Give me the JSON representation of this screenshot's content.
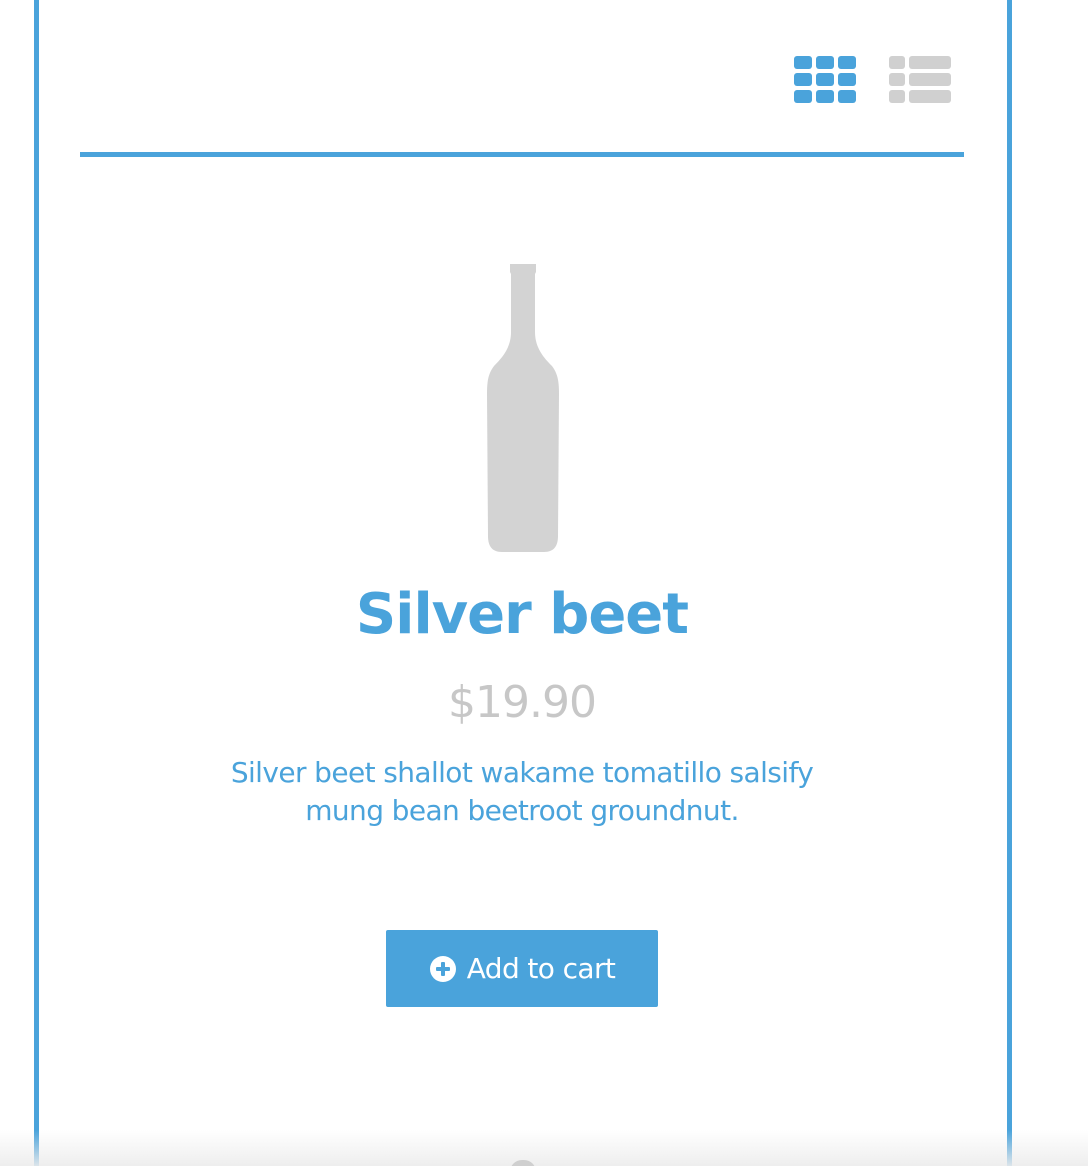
{
  "colors": {
    "accent": "#4aa3db",
    "price": "#c7c7c7",
    "inactive_icon": "#d0d0d0",
    "placeholder_image": "#d3d3d3"
  },
  "view_toggle": {
    "grid_icon": "grid-icon",
    "list_icon": "list-icon",
    "active": "grid"
  },
  "product": {
    "image_icon": "bottle-icon",
    "name": "Silver beet",
    "price": "$19.90",
    "description": "Silver beet shallot wakame tomatillo salsify mung bean beetroot groundnut."
  },
  "cart_button": {
    "icon": "plus-circle-icon",
    "label": "Add to cart"
  }
}
